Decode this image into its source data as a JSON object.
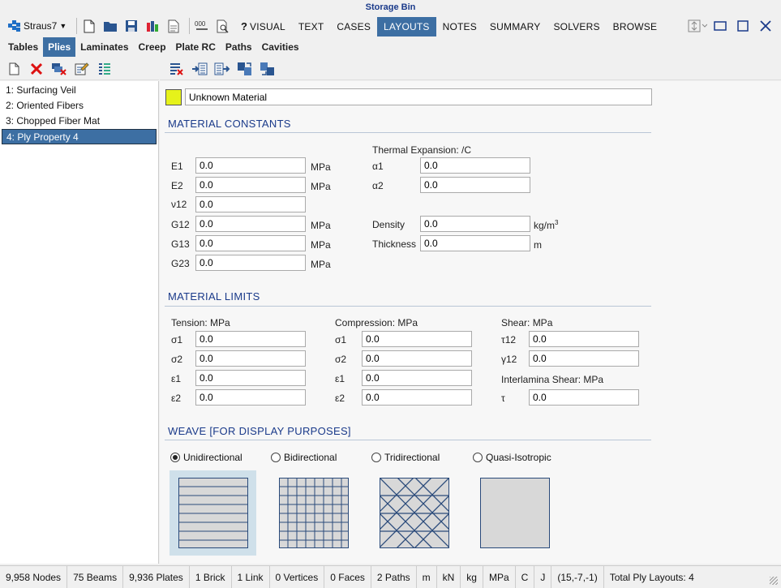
{
  "window": {
    "title": "Storage Bin"
  },
  "app_menu": {
    "label": "Straus7"
  },
  "menubar": [
    "VISUAL",
    "TEXT",
    "CASES",
    "LAYOUTS",
    "NOTES",
    "SUMMARY",
    "SOLVERS",
    "BROWSE"
  ],
  "menubar_active": "LAYOUTS",
  "qa": {
    "help_label": "?"
  },
  "tabs": [
    "Tables",
    "Plies",
    "Laminates",
    "Creep",
    "Plate RC",
    "Paths",
    "Cavities"
  ],
  "tabs_active": "Plies",
  "plies": [
    {
      "label": "1: Surfacing Veil"
    },
    {
      "label": "2: Oriented Fibers"
    },
    {
      "label": "3: Chopped Fiber Mat"
    },
    {
      "label": "4: Ply Property 4",
      "selected": true
    }
  ],
  "material": {
    "name": "Unknown Material",
    "color": "#e6f21a"
  },
  "constants": {
    "title": "MATERIAL CONSTANTS",
    "E1": {
      "label": "E1",
      "value": "0.0",
      "unit": "MPa"
    },
    "E2": {
      "label": "E2",
      "value": "0.0",
      "unit": "MPa"
    },
    "nu12": {
      "label": "ν12",
      "value": "0.0"
    },
    "G12": {
      "label": "G12",
      "value": "0.0",
      "unit": "MPa"
    },
    "G13": {
      "label": "G13",
      "value": "0.0",
      "unit": "MPa"
    },
    "G23": {
      "label": "G23",
      "value": "0.0",
      "unit": "MPa"
    },
    "thermal_title": "Thermal Expansion: /C",
    "alpha1": {
      "label": "α1",
      "value": "0.0"
    },
    "alpha2": {
      "label": "α2",
      "value": "0.0"
    },
    "density": {
      "label": "Density",
      "value": "0.0",
      "unit": "kg/m",
      "unit_sup": "3"
    },
    "thickness": {
      "label": "Thickness",
      "value": "0.0",
      "unit": "m"
    }
  },
  "limits": {
    "title": "MATERIAL LIMITS",
    "tension": {
      "title": "Tension: MPa",
      "s1": "0.0",
      "s2": "0.0",
      "e1": "0.0",
      "e2": "0.0"
    },
    "compression": {
      "title": "Compression: MPa",
      "s1": "0.0",
      "s2": "0.0",
      "e1": "0.0",
      "e2": "0.0"
    },
    "shear": {
      "title": "Shear: MPa",
      "t12": "0.0",
      "g12": "0.0"
    },
    "interlamina": {
      "title": "Interlamina Shear: MPa",
      "t": "0.0"
    },
    "labels": {
      "s1": "σ1",
      "s2": "σ2",
      "e1": "ε1",
      "e2": "ε2",
      "t12": "τ12",
      "g12": "γ12",
      "t": "τ"
    }
  },
  "weave": {
    "title": "WEAVE [FOR DISPLAY PURPOSES]",
    "options": [
      "Unidirectional",
      "Bidirectional",
      "Tridirectional",
      "Quasi-Isotropic"
    ],
    "selected": "Unidirectional"
  },
  "status": [
    "9,958 Nodes",
    "75 Beams",
    "9,936 Plates",
    "1 Brick",
    "1 Link",
    "0 Vertices",
    "0 Faces",
    "2 Paths",
    "m",
    "kN",
    "kg",
    "MPa",
    "C",
    "J",
    "(15,-7,-1)",
    "Total Ply Layouts: 4"
  ]
}
